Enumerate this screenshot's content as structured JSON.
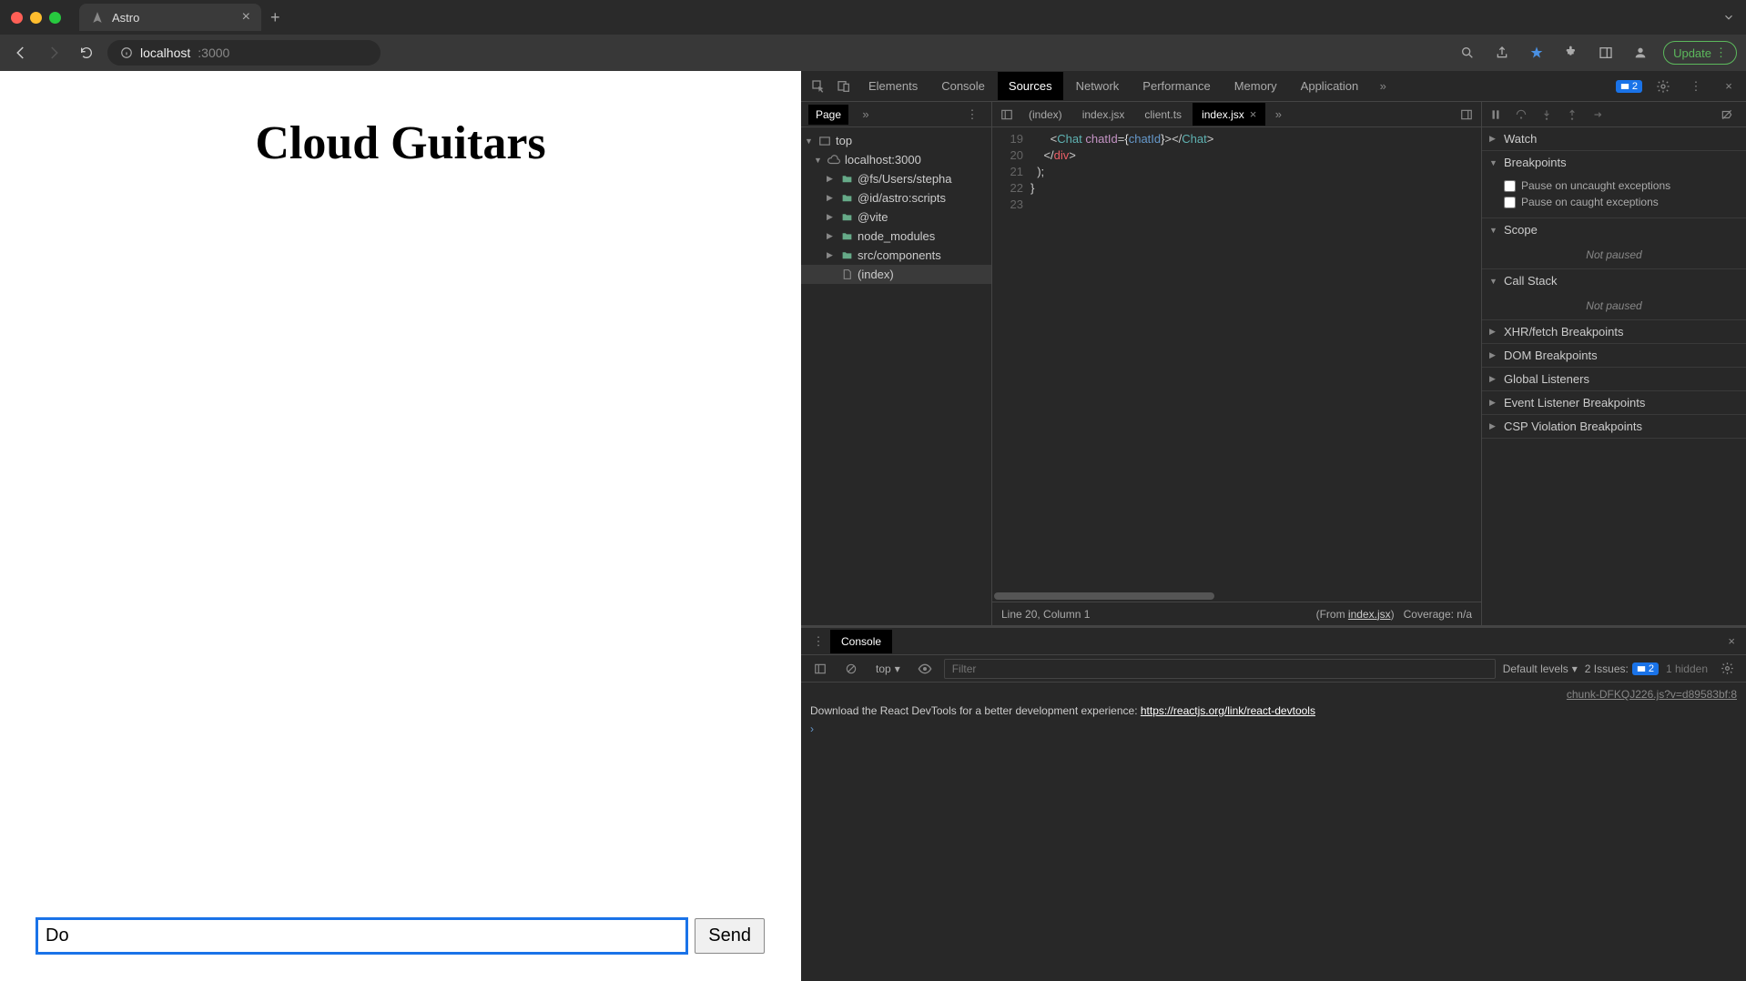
{
  "browser": {
    "tab_title": "Astro",
    "url_host": "localhost",
    "url_path": ":3000",
    "update_label": "Update"
  },
  "webpage": {
    "heading": "Cloud Guitars",
    "chat_input_value": "Do",
    "send_label": "Send"
  },
  "devtools": {
    "tabs": [
      "Elements",
      "Console",
      "Sources",
      "Network",
      "Performance",
      "Memory",
      "Application"
    ],
    "active_tab": "Sources",
    "issues_count": "2",
    "nav": {
      "tab_label": "Page",
      "tree": {
        "root": "top",
        "host": "localhost:3000",
        "items": [
          "@fs/Users/stepha",
          "@id/astro:scripts",
          "@vite",
          "node_modules",
          "src/components",
          "(index)"
        ]
      }
    },
    "editor": {
      "open_tabs": [
        "(index)",
        "index.jsx",
        "client.ts",
        "index.jsx"
      ],
      "active_tab_index": 3,
      "gutter": [
        "19",
        "20",
        "21",
        "22",
        "23"
      ],
      "status_left": "Line 20, Column 1",
      "status_from": "(From ",
      "status_from_link": "index.jsx",
      "status_coverage": "Coverage: n/a"
    },
    "debugger": {
      "sections": {
        "watch": "Watch",
        "breakpoints": "Breakpoints",
        "bp_uncaught": "Pause on uncaught exceptions",
        "bp_caught": "Pause on caught exceptions",
        "scope": "Scope",
        "scope_body": "Not paused",
        "callstack": "Call Stack",
        "callstack_body": "Not paused",
        "xhr": "XHR/fetch Breakpoints",
        "dom": "DOM Breakpoints",
        "global": "Global Listeners",
        "event": "Event Listener Breakpoints",
        "csp": "CSP Violation Breakpoints"
      }
    },
    "console": {
      "tab_label": "Console",
      "context": "top",
      "filter_placeholder": "Filter",
      "levels_label": "Default levels",
      "issues_label": "2 Issues:",
      "issues_count": "2",
      "hidden_label": "1 hidden",
      "log_src": "chunk-DFKQJ226.js?v=d89583bf:8",
      "log_text": "Download the React DevTools for a better development experience: ",
      "log_link": "https://reactjs.org/link/react-devtools"
    }
  }
}
